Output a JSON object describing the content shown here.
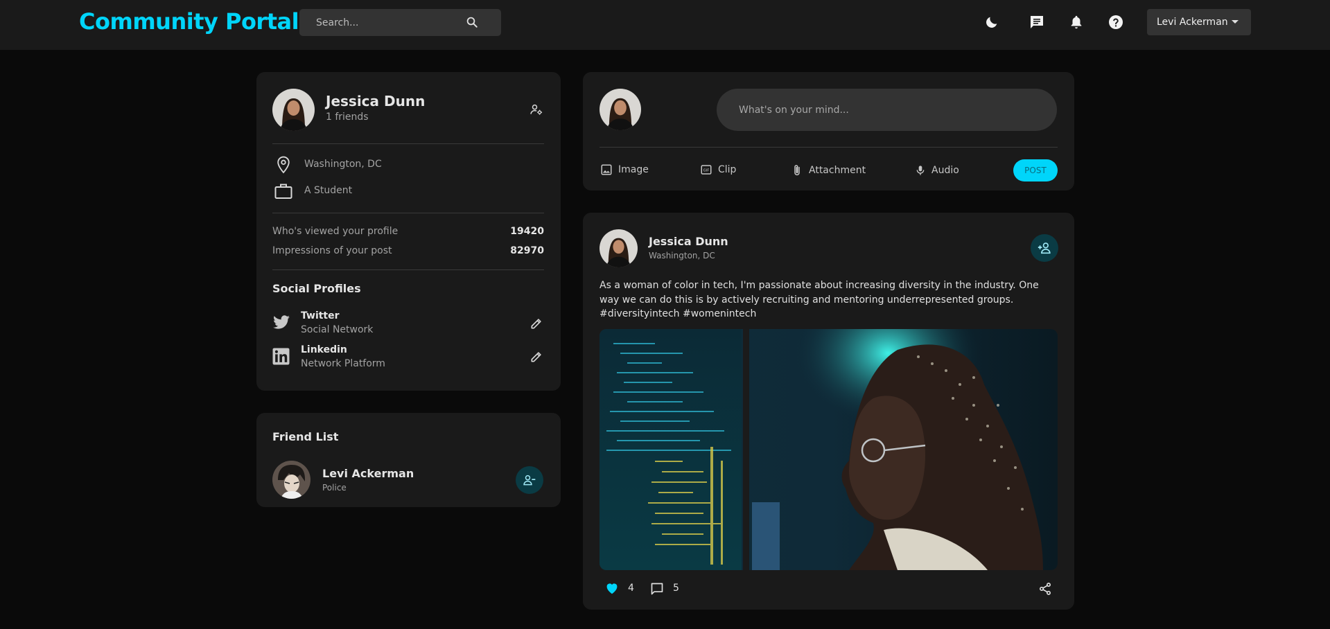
{
  "header": {
    "logo": "Community Portal",
    "search_placeholder": "Search...",
    "user_name": "Levi Ackerman"
  },
  "profile": {
    "name": "Jessica Dunn",
    "friends": "1 friends",
    "location": "Washington, DC",
    "occupation": "A Student",
    "stats": [
      {
        "label": "Who's viewed your profile",
        "value": "19420"
      },
      {
        "label": "Impressions of your post",
        "value": "82970"
      }
    ],
    "social_title": "Social Profiles",
    "social": [
      {
        "name": "Twitter",
        "sub": "Social Network",
        "icon": "twitter-icon"
      },
      {
        "name": "Linkedin",
        "sub": "Network Platform",
        "icon": "linkedin-icon"
      }
    ]
  },
  "friend_list": {
    "title": "Friend List",
    "friends": [
      {
        "name": "Levi Ackerman",
        "role": "Police"
      }
    ]
  },
  "composer": {
    "placeholder": "What's on your mind...",
    "actions": [
      "Image",
      "Clip",
      "Attachment",
      "Audio"
    ],
    "post_label": "POST"
  },
  "post": {
    "author": "Jessica Dunn",
    "location": "Washington, DC",
    "body": "As a woman of color in tech, I'm passionate about increasing diversity in the industry. One way we can do this is by actively recruiting and mentoring underrepresented groups. #diversityintech #womenintech",
    "likes": "4",
    "comments": "5"
  },
  "colors": {
    "accent": "#00d5fa",
    "card": "#1a1a1a",
    "background": "#0a0a0a"
  }
}
